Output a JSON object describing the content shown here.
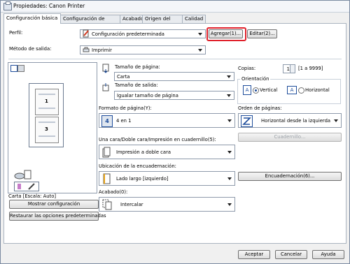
{
  "window": {
    "title": "Propiedades: Canon Printer"
  },
  "tabs": [
    {
      "label": "Configuración básica"
    },
    {
      "label": "Configuración de página"
    },
    {
      "label": "Acabado"
    },
    {
      "label": "Origen del papel"
    },
    {
      "label": "Calidad"
    }
  ],
  "profile": {
    "label": "Perfil:",
    "value": "Configuración predeterminada",
    "add_button": "Agregar(1)...",
    "edit_button": "Editar(2)..."
  },
  "output": {
    "label": "Método de salida:",
    "value": "Imprimir"
  },
  "preview": {
    "caption": "Carta [Escala: Auto]",
    "pages": [
      "1",
      "3"
    ]
  },
  "page_size": {
    "label": "Tamaño de página:",
    "value": "Carta"
  },
  "output_size": {
    "label": "Tamaño de salida:",
    "value": "Igualar tamaño de página"
  },
  "copies": {
    "label": "Copias:",
    "value": "1",
    "range": "[1 a 9999]"
  },
  "orientation": {
    "label": "Orientación",
    "vertical": "Vertical",
    "horizontal": "Horizontal",
    "selected": "Vertical"
  },
  "page_format": {
    "label": "Formato de página(Y):",
    "value": "4 en 1",
    "icon_num": "4"
  },
  "page_order": {
    "label": "Orden de páginas:",
    "value": "Horizontal desde la izquierda"
  },
  "booklet_button": "Cuadernillo...",
  "duplex": {
    "label": "Una cara/Doble cara/Impresión en cuadernillo(5):",
    "value": "Impresión a doble cara"
  },
  "binding_location": {
    "label": "Ubicación de la encuadernación:",
    "value": "Lado largo [izquierdo]"
  },
  "binding_button": "Encuadernación(6)...",
  "finishing": {
    "label": "Acabado(0):",
    "value": "Intercalar"
  },
  "show_settings_button": "Mostrar configuración",
  "restore_defaults_button": "Restaurar las opciones predeterminadas",
  "footer": {
    "ok": "Aceptar",
    "cancel": "Cancelar",
    "help": "Ayuda"
  },
  "colors": {
    "highlight": "#e0202a",
    "accent": "#1e4d9b"
  }
}
